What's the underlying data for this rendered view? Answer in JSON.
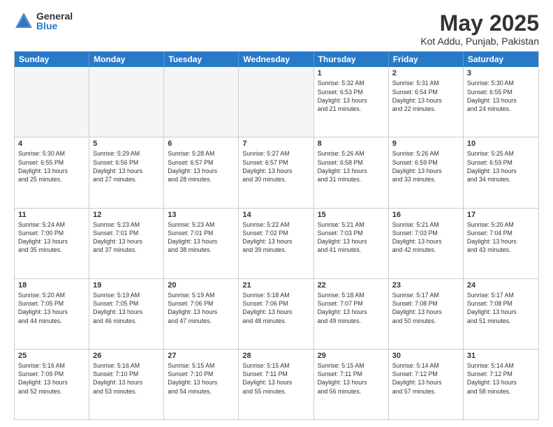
{
  "logo": {
    "general": "General",
    "blue": "Blue"
  },
  "title": "May 2025",
  "subtitle": "Kot Addu, Punjab, Pakistan",
  "days": [
    "Sunday",
    "Monday",
    "Tuesday",
    "Wednesday",
    "Thursday",
    "Friday",
    "Saturday"
  ],
  "weeks": [
    [
      {
        "day": "",
        "info": ""
      },
      {
        "day": "",
        "info": ""
      },
      {
        "day": "",
        "info": ""
      },
      {
        "day": "",
        "info": ""
      },
      {
        "day": "1",
        "info": "Sunrise: 5:32 AM\nSunset: 6:53 PM\nDaylight: 13 hours\nand 21 minutes."
      },
      {
        "day": "2",
        "info": "Sunrise: 5:31 AM\nSunset: 6:54 PM\nDaylight: 13 hours\nand 22 minutes."
      },
      {
        "day": "3",
        "info": "Sunrise: 5:30 AM\nSunset: 6:55 PM\nDaylight: 13 hours\nand 24 minutes."
      }
    ],
    [
      {
        "day": "4",
        "info": "Sunrise: 5:30 AM\nSunset: 6:55 PM\nDaylight: 13 hours\nand 25 minutes."
      },
      {
        "day": "5",
        "info": "Sunrise: 5:29 AM\nSunset: 6:56 PM\nDaylight: 13 hours\nand 27 minutes."
      },
      {
        "day": "6",
        "info": "Sunrise: 5:28 AM\nSunset: 6:57 PM\nDaylight: 13 hours\nand 28 minutes."
      },
      {
        "day": "7",
        "info": "Sunrise: 5:27 AM\nSunset: 6:57 PM\nDaylight: 13 hours\nand 30 minutes."
      },
      {
        "day": "8",
        "info": "Sunrise: 5:26 AM\nSunset: 6:58 PM\nDaylight: 13 hours\nand 31 minutes."
      },
      {
        "day": "9",
        "info": "Sunrise: 5:26 AM\nSunset: 6:59 PM\nDaylight: 13 hours\nand 33 minutes."
      },
      {
        "day": "10",
        "info": "Sunrise: 5:25 AM\nSunset: 6:59 PM\nDaylight: 13 hours\nand 34 minutes."
      }
    ],
    [
      {
        "day": "11",
        "info": "Sunrise: 5:24 AM\nSunset: 7:00 PM\nDaylight: 13 hours\nand 35 minutes."
      },
      {
        "day": "12",
        "info": "Sunrise: 5:23 AM\nSunset: 7:01 PM\nDaylight: 13 hours\nand 37 minutes."
      },
      {
        "day": "13",
        "info": "Sunrise: 5:23 AM\nSunset: 7:01 PM\nDaylight: 13 hours\nand 38 minutes."
      },
      {
        "day": "14",
        "info": "Sunrise: 5:22 AM\nSunset: 7:02 PM\nDaylight: 13 hours\nand 39 minutes."
      },
      {
        "day": "15",
        "info": "Sunrise: 5:21 AM\nSunset: 7:03 PM\nDaylight: 13 hours\nand 41 minutes."
      },
      {
        "day": "16",
        "info": "Sunrise: 5:21 AM\nSunset: 7:03 PM\nDaylight: 13 hours\nand 42 minutes."
      },
      {
        "day": "17",
        "info": "Sunrise: 5:20 AM\nSunset: 7:04 PM\nDaylight: 13 hours\nand 43 minutes."
      }
    ],
    [
      {
        "day": "18",
        "info": "Sunrise: 5:20 AM\nSunset: 7:05 PM\nDaylight: 13 hours\nand 44 minutes."
      },
      {
        "day": "19",
        "info": "Sunrise: 5:19 AM\nSunset: 7:05 PM\nDaylight: 13 hours\nand 46 minutes."
      },
      {
        "day": "20",
        "info": "Sunrise: 5:19 AM\nSunset: 7:06 PM\nDaylight: 13 hours\nand 47 minutes."
      },
      {
        "day": "21",
        "info": "Sunrise: 5:18 AM\nSunset: 7:06 PM\nDaylight: 13 hours\nand 48 minutes."
      },
      {
        "day": "22",
        "info": "Sunrise: 5:18 AM\nSunset: 7:07 PM\nDaylight: 13 hours\nand 49 minutes."
      },
      {
        "day": "23",
        "info": "Sunrise: 5:17 AM\nSunset: 7:08 PM\nDaylight: 13 hours\nand 50 minutes."
      },
      {
        "day": "24",
        "info": "Sunrise: 5:17 AM\nSunset: 7:08 PM\nDaylight: 13 hours\nand 51 minutes."
      }
    ],
    [
      {
        "day": "25",
        "info": "Sunrise: 5:16 AM\nSunset: 7:09 PM\nDaylight: 13 hours\nand 52 minutes."
      },
      {
        "day": "26",
        "info": "Sunrise: 5:16 AM\nSunset: 7:10 PM\nDaylight: 13 hours\nand 53 minutes."
      },
      {
        "day": "27",
        "info": "Sunrise: 5:15 AM\nSunset: 7:10 PM\nDaylight: 13 hours\nand 54 minutes."
      },
      {
        "day": "28",
        "info": "Sunrise: 5:15 AM\nSunset: 7:11 PM\nDaylight: 13 hours\nand 55 minutes."
      },
      {
        "day": "29",
        "info": "Sunrise: 5:15 AM\nSunset: 7:11 PM\nDaylight: 13 hours\nand 56 minutes."
      },
      {
        "day": "30",
        "info": "Sunrise: 5:14 AM\nSunset: 7:12 PM\nDaylight: 13 hours\nand 57 minutes."
      },
      {
        "day": "31",
        "info": "Sunrise: 5:14 AM\nSunset: 7:12 PM\nDaylight: 13 hours\nand 58 minutes."
      }
    ]
  ]
}
